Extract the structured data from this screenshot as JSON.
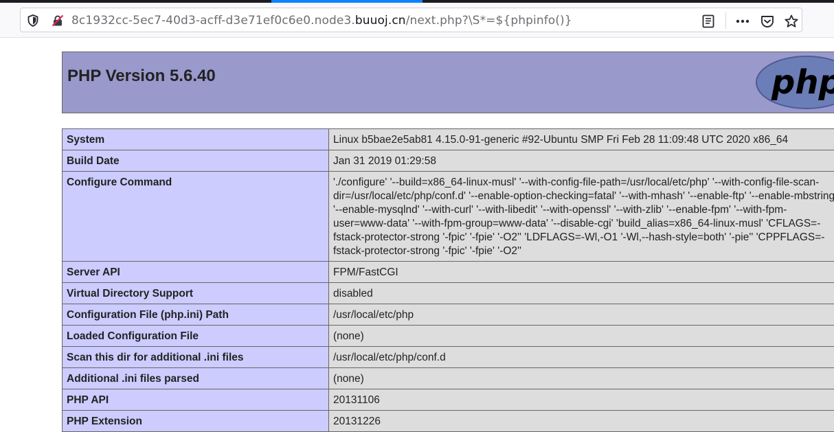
{
  "browser": {
    "url_prefix": "8c1932cc-5ec7-40d3-acff-d3e71ef0c6e0.node3.",
    "url_domain": "buuoj.cn",
    "url_suffix": "/next.php?\\S*=${phpinfo()}",
    "icons": [
      "shield-icon",
      "insecure-lock-icon",
      "reader-view-icon",
      "more-icon",
      "pocket-icon",
      "bookmark-star-icon"
    ]
  },
  "php": {
    "title": "PHP Version 5.6.40",
    "logo_text": "php",
    "rows": [
      {
        "key": "System",
        "value": "Linux b5bae2e5ab81 4.15.0-91-generic #92-Ubuntu SMP Fri Feb 28 11:09:48 UTC 2020 x86_64"
      },
      {
        "key": "Build Date",
        "value": "Jan 31 2019 01:29:58"
      },
      {
        "key": "Configure Command",
        "value": "'./configure' '--build=x86_64-linux-musl' '--with-config-file-path=/usr/local/etc/php' '--with-config-file-scan-dir=/usr/local/etc/php/conf.d' '--enable-option-checking=fatal' '--with-mhash' '--enable-ftp' '--enable-mbstring' '--enable-mysqlnd' '--with-curl' '--with-libedit' '--with-openssl' '--with-zlib' '--enable-fpm' '--with-fpm-user=www-data' '--with-fpm-group=www-data' '--disable-cgi' 'build_alias=x86_64-linux-musl' 'CFLAGS=-fstack-protector-strong '-fpic' '-fpie' '-O2'' 'LDFLAGS=-Wl,-O1 '-Wl,--hash-style=both' '-pie'' 'CPPFLAGS=-fstack-protector-strong '-fpic' '-fpie' '-O2''"
      },
      {
        "key": "Server API",
        "value": "FPM/FastCGI"
      },
      {
        "key": "Virtual Directory Support",
        "value": "disabled"
      },
      {
        "key": "Configuration File (php.ini) Path",
        "value": "/usr/local/etc/php"
      },
      {
        "key": "Loaded Configuration File",
        "value": "(none)"
      },
      {
        "key": "Scan this dir for additional .ini files",
        "value": "/usr/local/etc/php/conf.d"
      },
      {
        "key": "Additional .ini files parsed",
        "value": "(none)"
      },
      {
        "key": "PHP API",
        "value": "20131106"
      },
      {
        "key": "PHP Extension",
        "value": "20131226"
      }
    ]
  }
}
